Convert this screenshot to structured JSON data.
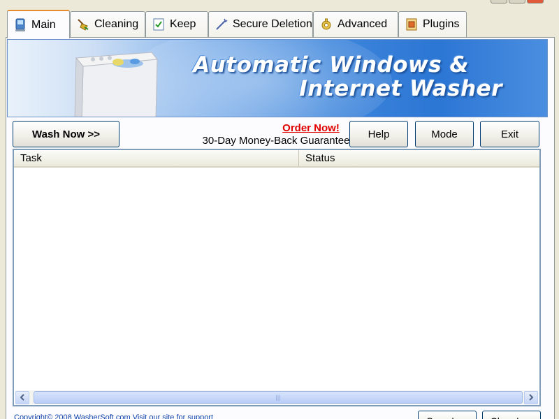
{
  "tabs": [
    {
      "label": "Main",
      "icon": "computer-icon"
    },
    {
      "label": "Cleaning",
      "icon": "broom-icon"
    },
    {
      "label": "Keep",
      "icon": "checklist-icon"
    },
    {
      "label": "Secure Deletion",
      "icon": "wand-icon"
    },
    {
      "label": "Advanced",
      "icon": "gear-icon"
    },
    {
      "label": "Plugins",
      "icon": "plugin-icon"
    }
  ],
  "active_tab": "Main",
  "banner": {
    "line1": "Automatic Windows &",
    "line2": "Internet Washer"
  },
  "actions": {
    "wash_now": "Wash Now >>",
    "order_now": "Order Now!",
    "guarantee": "30-Day Money-Back Guarantee",
    "help": "Help",
    "mode": "Mode",
    "exit": "Exit"
  },
  "log_table": {
    "columns": [
      "Task",
      "Status"
    ],
    "rows": []
  },
  "scrollbar": {
    "grip": "|||"
  },
  "footer": {
    "copyright": "Copyright© 2008 WasherSoft.com   Visit our site for support",
    "save_log": "Save Log",
    "clear_log": "Clear Log"
  },
  "colors": {
    "accent_tab": "#e68b2c",
    "order_link": "#e00000",
    "banner_blue": "#2c76d4"
  }
}
